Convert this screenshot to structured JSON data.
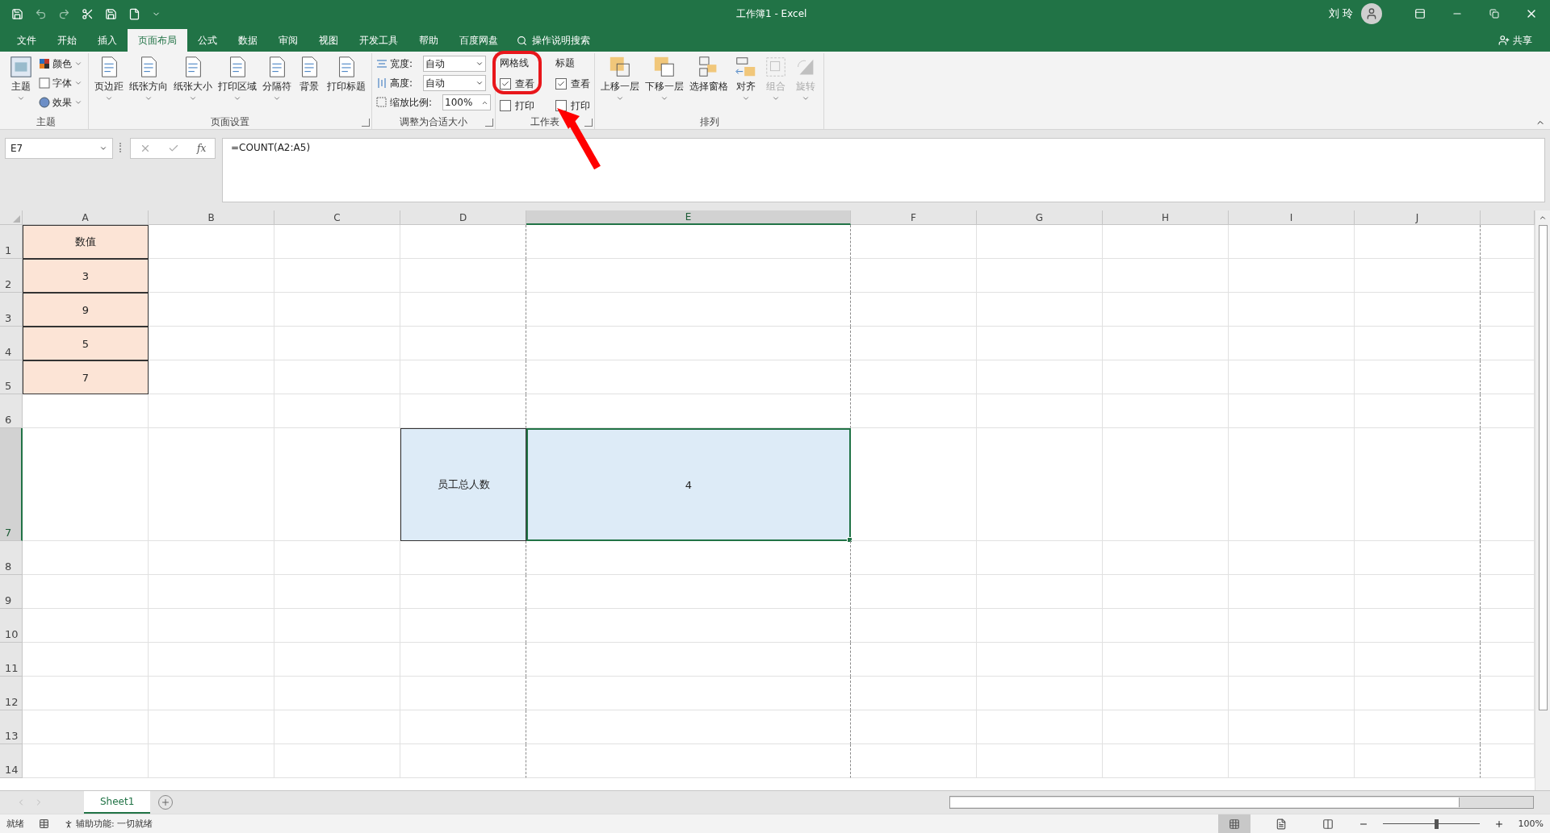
{
  "window": {
    "title": "工作簿1  -  Excel",
    "user": "刘 玲"
  },
  "tabs": [
    {
      "label": "文件",
      "selected": false
    },
    {
      "label": "开始",
      "selected": false
    },
    {
      "label": "插入",
      "selected": false
    },
    {
      "label": "页面布局",
      "selected": true
    },
    {
      "label": "公式",
      "selected": false
    },
    {
      "label": "数据",
      "selected": false
    },
    {
      "label": "审阅",
      "selected": false
    },
    {
      "label": "视图",
      "selected": false
    },
    {
      "label": "开发工具",
      "selected": false
    },
    {
      "label": "帮助",
      "selected": false
    },
    {
      "label": "百度网盘",
      "selected": false
    }
  ],
  "search": {
    "placeholder": "操作说明搜索"
  },
  "share": "共享",
  "ribbon": {
    "groups": [
      {
        "title": "主题",
        "launcher": false,
        "items": [
          {
            "kind": "large",
            "label": "主题",
            "caret": true,
            "disabled": false
          },
          {
            "kind": "small",
            "label": "颜色",
            "caret": true
          },
          {
            "kind": "small",
            "label": "字体",
            "caret": true
          },
          {
            "kind": "small",
            "label": "效果",
            "caret": true
          }
        ]
      },
      {
        "title": "页面设置",
        "launcher": true,
        "items": [
          {
            "kind": "large",
            "label": "页边距",
            "caret": true,
            "disabled": false
          },
          {
            "kind": "large",
            "label": "纸张方向",
            "caret": true,
            "disabled": false
          },
          {
            "kind": "large",
            "label": "纸张大小",
            "caret": true,
            "disabled": false
          },
          {
            "kind": "large",
            "label": "打印区域",
            "caret": true,
            "disabled": false
          },
          {
            "kind": "large",
            "label": "分隔符",
            "caret": true,
            "disabled": false
          },
          {
            "kind": "large",
            "label": "背景",
            "caret": false,
            "disabled": false
          },
          {
            "kind": "large",
            "label": "打印标题",
            "caret": false,
            "disabled": false
          }
        ]
      },
      {
        "title": "调整为合适大小",
        "launcher": true,
        "items": [
          {
            "kind": "field",
            "label": "宽度:",
            "value": "自动"
          },
          {
            "kind": "field",
            "label": "高度:",
            "value": "自动"
          },
          {
            "kind": "spin",
            "label": "缩放比例:",
            "value": "100%"
          }
        ]
      },
      {
        "title": "工作表",
        "launcher": true,
        "items": [
          {
            "kind": "heading",
            "label": "网格线"
          },
          {
            "kind": "check",
            "label": "查看",
            "checked": true
          },
          {
            "kind": "check",
            "label": "打印",
            "checked": false
          },
          {
            "kind": "heading",
            "label": "标题"
          },
          {
            "kind": "check",
            "label": "查看",
            "checked": true
          },
          {
            "kind": "check",
            "label": "打印",
            "checked": false
          }
        ]
      },
      {
        "title": "排列",
        "launcher": false,
        "items": [
          {
            "kind": "large",
            "label": "上移一层",
            "caret": true,
            "disabled": false
          },
          {
            "kind": "large",
            "label": "下移一层",
            "caret": true,
            "disabled": false
          },
          {
            "kind": "large",
            "label": "选择窗格",
            "caret": false,
            "disabled": false
          },
          {
            "kind": "large",
            "label": "对齐",
            "caret": true,
            "disabled": false
          },
          {
            "kind": "large",
            "label": "组合",
            "caret": true,
            "disabled": true
          },
          {
            "kind": "large",
            "label": "旋转",
            "caret": true,
            "disabled": true
          }
        ]
      }
    ]
  },
  "formula_bar": {
    "name_box": "E7",
    "fx": "fx",
    "formula": "=COUNT(A2:A5)"
  },
  "sheet": {
    "columns": [
      {
        "label": "A",
        "selected": false,
        "page_break": false
      },
      {
        "label": "B",
        "selected": false,
        "page_break": false
      },
      {
        "label": "C",
        "selected": false,
        "page_break": false
      },
      {
        "label": "D",
        "selected": false,
        "page_break": true
      },
      {
        "label": "E",
        "selected": true,
        "page_break": true
      },
      {
        "label": "F",
        "selected": false,
        "page_break": false
      },
      {
        "label": "G",
        "selected": false,
        "page_break": false
      },
      {
        "label": "H",
        "selected": false,
        "page_break": false
      },
      {
        "label": "I",
        "selected": false,
        "page_break": false
      },
      {
        "label": "J",
        "selected": false,
        "page_break": true
      }
    ],
    "rows": [
      {
        "label": "1",
        "selected": false,
        "tall": false,
        "cells": [
          {
            "text": "数值",
            "kind": "source",
            "selected": false
          }
        ]
      },
      {
        "label": "2",
        "selected": false,
        "tall": false,
        "cells": [
          {
            "text": "3",
            "kind": "source",
            "selected": false
          }
        ]
      },
      {
        "label": "3",
        "selected": false,
        "tall": false,
        "cells": [
          {
            "text": "9",
            "kind": "source",
            "selected": false
          }
        ]
      },
      {
        "label": "4",
        "selected": false,
        "tall": false,
        "cells": [
          {
            "text": "5",
            "kind": "source",
            "selected": false
          }
        ]
      },
      {
        "label": "5",
        "selected": false,
        "tall": false,
        "cells": [
          {
            "text": "7",
            "kind": "source",
            "selected": false
          }
        ]
      },
      {
        "label": "6",
        "selected": false,
        "tall": false,
        "cells": []
      },
      {
        "label": "7",
        "selected": true,
        "tall": true,
        "cells": [
          {
            "text": "",
            "kind": "plain",
            "selected": false
          },
          {
            "text": "",
            "kind": "plain",
            "selected": false
          },
          {
            "text": "",
            "kind": "plain",
            "selected": false
          },
          {
            "text": "员工总人数",
            "kind": "result",
            "selected": false
          },
          {
            "text": "4",
            "kind": "result",
            "selected": true
          }
        ]
      },
      {
        "label": "8",
        "selected": false,
        "tall": false,
        "cells": []
      },
      {
        "label": "9",
        "selected": false,
        "tall": false,
        "cells": []
      },
      {
        "label": "10",
        "selected": false,
        "tall": false,
        "cells": []
      },
      {
        "label": "11",
        "selected": false,
        "tall": false,
        "cells": []
      },
      {
        "label": "12",
        "selected": false,
        "tall": false,
        "cells": []
      },
      {
        "label": "13",
        "selected": false,
        "tall": false,
        "cells": []
      },
      {
        "label": "14",
        "selected": false,
        "tall": false,
        "cells": []
      }
    ],
    "sheet_tabs": [
      {
        "label": "Sheet1",
        "selected": true
      }
    ]
  },
  "status_bar": {
    "mode": "就绪",
    "accessibility": "辅助功能: 一切就绪",
    "zoom": "100%",
    "zoom_level": {
      "level": 0.55
    }
  }
}
